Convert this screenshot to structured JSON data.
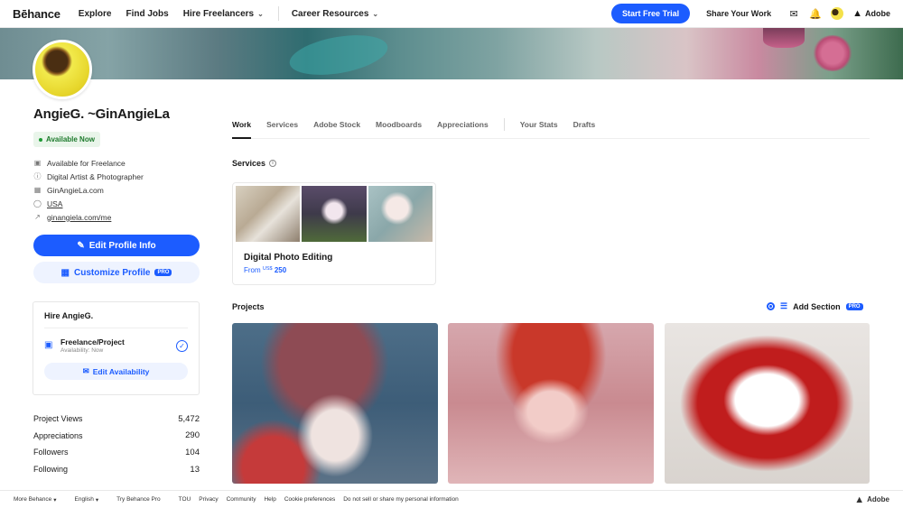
{
  "nav": {
    "logo": "Bēhance",
    "explore": "Explore",
    "find_jobs": "Find Jobs",
    "hire_freelancers": "Hire Freelancers",
    "career_resources": "Career Resources",
    "start_trial": "Start Free Trial",
    "share_work": "Share Your Work",
    "adobe": "Adobe"
  },
  "profile": {
    "name": "AngieG. ~GinAngieLa",
    "availability_badge": "Available Now",
    "details": {
      "freelance": "Available for Freelance",
      "occupation": "Digital Artist & Photographer",
      "website": "GinAngieLa.com",
      "location": "USA",
      "link": "ginangiela.com/me"
    },
    "edit_button": "Edit Profile Info",
    "customize_button": "Customize Profile",
    "pro_badge": "PRO"
  },
  "hire_card": {
    "title": "Hire AngieG.",
    "option_title": "Freelance/Project",
    "option_status": "Availability: Now",
    "edit_button": "Edit Availability"
  },
  "stats": {
    "project_views_label": "Project Views",
    "project_views": "5,472",
    "appreciations_label": "Appreciations",
    "appreciations": "290",
    "followers_label": "Followers",
    "followers": "104",
    "following_label": "Following",
    "following": "13"
  },
  "tabs": {
    "work": "Work",
    "services": "Services",
    "stock": "Adobe Stock",
    "moodboards": "Moodboards",
    "appreciations": "Appreciations",
    "stats": "Your Stats",
    "drafts": "Drafts"
  },
  "services": {
    "title": "Services",
    "card_name": "Digital Photo Editing",
    "price_prefix": "From",
    "currency": "US$",
    "price": "250"
  },
  "projects": {
    "title": "Projects",
    "add_section": "Add Section",
    "pro_badge": "PRO"
  },
  "footer": {
    "more": "More Behance",
    "language": "English",
    "try_pro": "Try Behance Pro",
    "tou": "TOU",
    "privacy": "Privacy",
    "community": "Community",
    "help": "Help",
    "cookies": "Cookie preferences",
    "do_not_sell": "Do not sell or share my personal information",
    "adobe": "Adobe"
  },
  "colors": {
    "accent": "#1c5cff",
    "available_green": "#1d7a2c"
  }
}
